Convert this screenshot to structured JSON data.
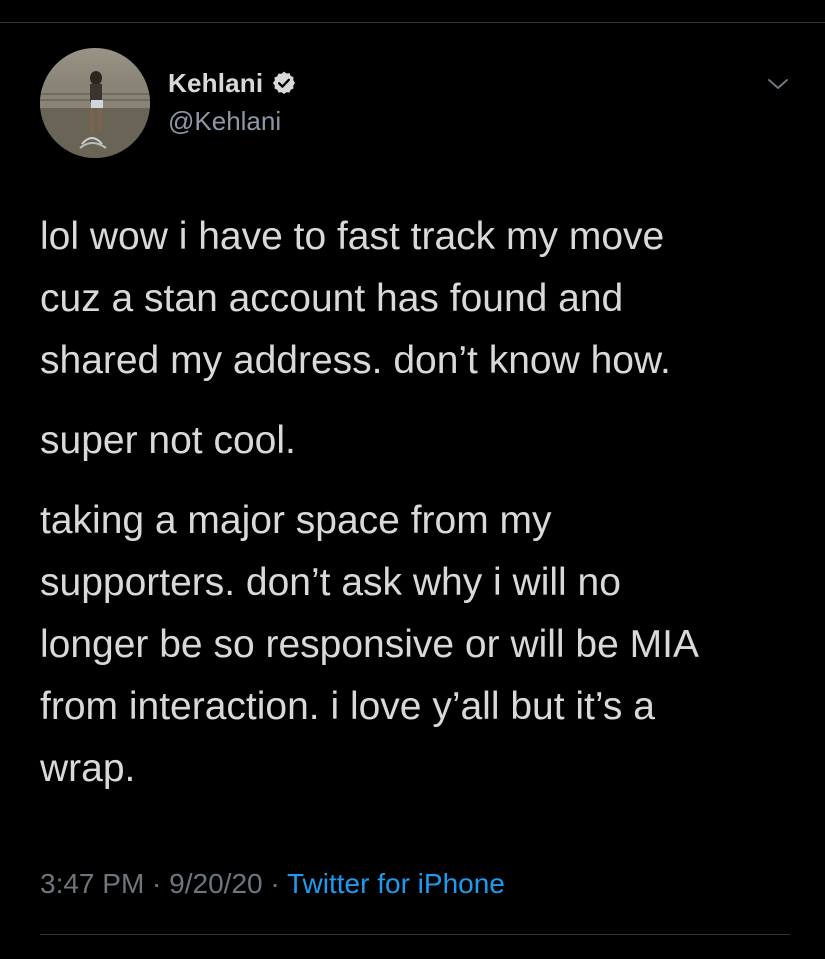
{
  "tweet": {
    "author": {
      "display_name": "Kehlani",
      "handle": "@Kehlani",
      "verified": true
    },
    "paragraphs": [
      "lol wow i have to fast track my move\ncuz a stan account has found and\nshared my address. don’t know how.",
      "super not cool.",
      "taking a major space from my\nsupporters. don’t ask why i will no\nlonger be so responsive or will be MIA\nfrom interaction. i love y’all but it’s a\nwrap."
    ],
    "meta": {
      "time": "3:47 PM",
      "separator": " · ",
      "date": "9/20/20",
      "source": "Twitter for iPhone"
    }
  },
  "icons": {
    "verified": "verified-badge-icon",
    "more": "chevron-down-icon"
  },
  "colors": {
    "background": "#000000",
    "text": "#d9d9d9",
    "secondary_text": "#8b98a5",
    "link": "#1d9bf0",
    "divider": "#2f3336"
  }
}
